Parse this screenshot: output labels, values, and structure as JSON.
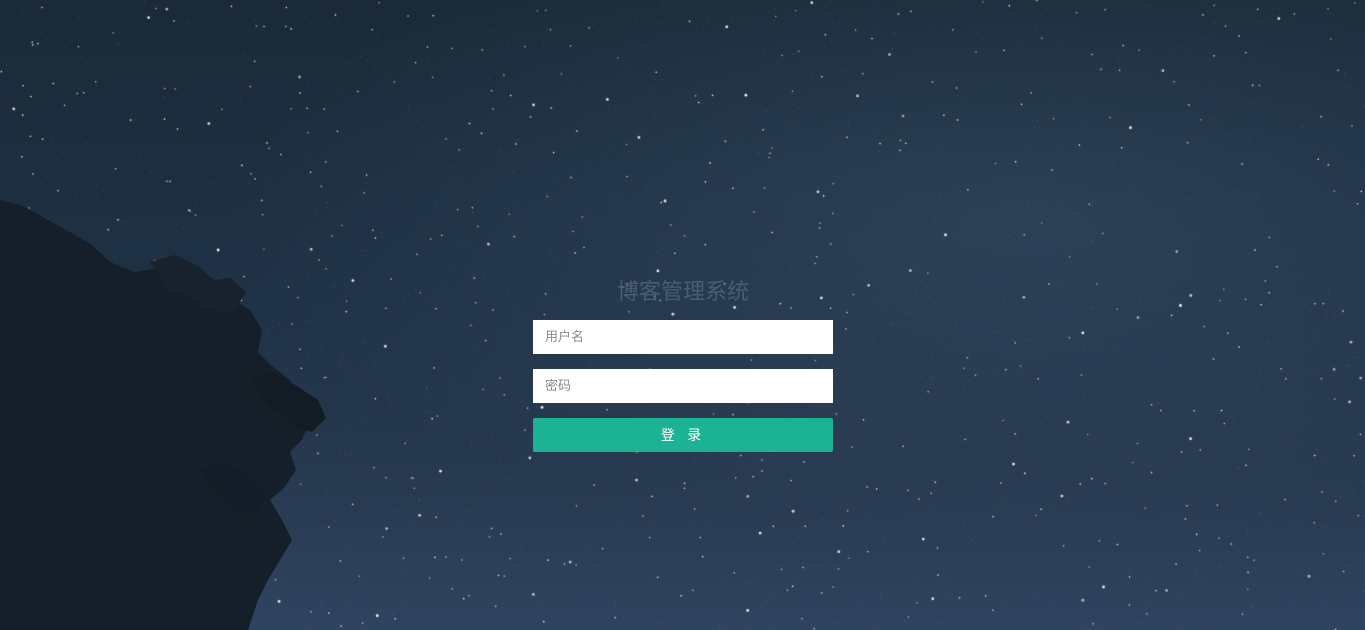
{
  "login": {
    "title": "博客管理系统",
    "username_placeholder": "用户名",
    "password_placeholder": "密码",
    "submit_label": "登 录"
  },
  "colors": {
    "accent": "#1bb394",
    "title": "#4a5d70",
    "sky_top": "#1a2a38",
    "sky_bottom": "#2f4460"
  }
}
